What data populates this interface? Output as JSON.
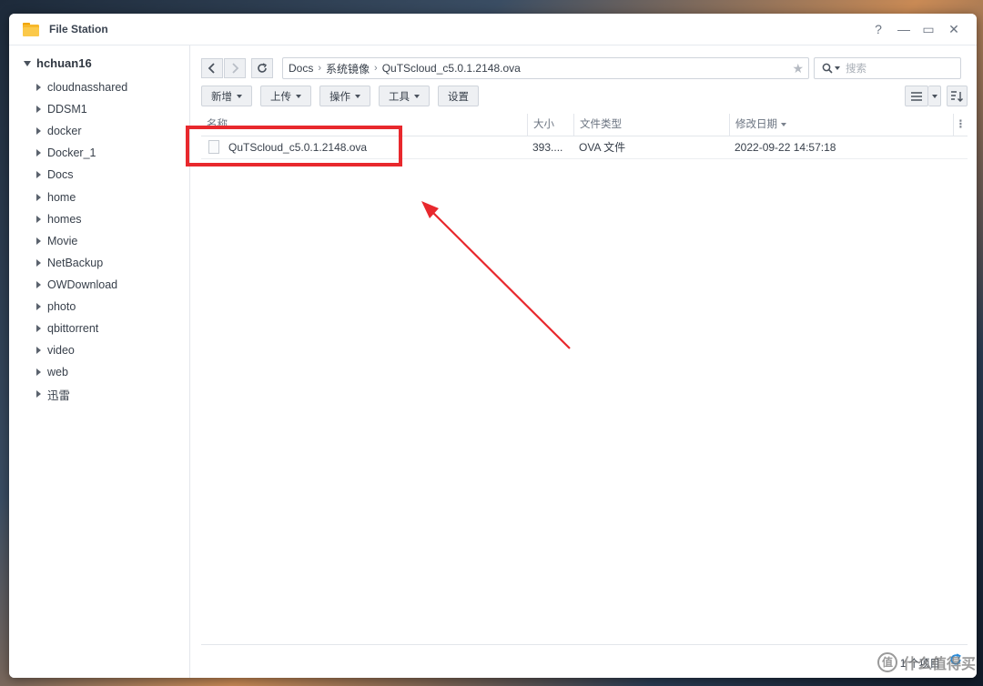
{
  "window": {
    "title": "File Station",
    "controls": {
      "help": "?",
      "minimize": "—",
      "maximize": "▭",
      "close": "✕"
    }
  },
  "sidebar": {
    "root": "hchuan16",
    "items": [
      {
        "label": "cloudnasshared"
      },
      {
        "label": "DDSM1"
      },
      {
        "label": "docker"
      },
      {
        "label": "Docker_1"
      },
      {
        "label": "Docs"
      },
      {
        "label": "home"
      },
      {
        "label": "homes"
      },
      {
        "label": "Movie"
      },
      {
        "label": "NetBackup"
      },
      {
        "label": "OWDownload"
      },
      {
        "label": "photo"
      },
      {
        "label": "qbittorrent"
      },
      {
        "label": "video"
      },
      {
        "label": "web"
      },
      {
        "label": "迅雷"
      }
    ]
  },
  "navbar": {
    "back_icon": "chevron-left-icon",
    "forward_icon": "chevron-right-icon",
    "refresh_icon": "refresh-icon",
    "path": [
      "Docs",
      "系统镜像",
      "QuTScloud_c5.0.1.2148.ova"
    ],
    "search_placeholder": "搜索"
  },
  "toolbar": {
    "create": "新增",
    "upload": "上传",
    "action": "操作",
    "tools": "工具",
    "settings": "设置"
  },
  "table": {
    "headers": {
      "name": "名称",
      "size": "大小",
      "type": "文件类型",
      "modified": "修改日期"
    },
    "rows": [
      {
        "name": "QuTScloud_c5.0.1.2148.ova",
        "size": "393....",
        "type": "OVA 文件",
        "modified": "2022-09-22 14:57:18"
      }
    ]
  },
  "status": {
    "count": "1 个项目"
  },
  "annotation": {
    "highlight_color": "#e8282d"
  },
  "watermark": {
    "text": "什么值得买",
    "icon_text": "值"
  }
}
